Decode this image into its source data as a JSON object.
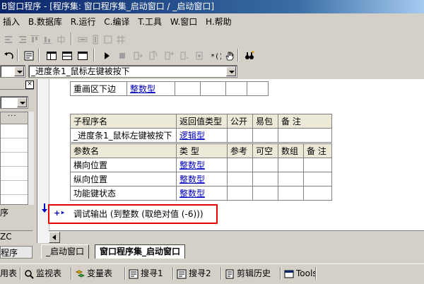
{
  "window": {
    "title": "B窗口程序 - [程序集: 窗口程序集_启动窗口 / _启动窗口]"
  },
  "menu": [
    {
      "label": "插入"
    },
    {
      "label": "B.数据库"
    },
    {
      "label": "R.运行"
    },
    {
      "label": "C.编译"
    },
    {
      "label": "T.工具"
    },
    {
      "label": "W.窗口"
    },
    {
      "label": "H.帮助"
    }
  ],
  "combo": {
    "selected": "_进度条1_鼠标左键被按下"
  },
  "left_panel": {
    "label1": "序",
    "label2": "ZC",
    "label3": "程序"
  },
  "top_table": {
    "cell1": "重画区下边",
    "cell2": "整数型"
  },
  "sub_table": {
    "header": [
      "子程序名",
      "返回值类型",
      "公开",
      "易包",
      "备 注"
    ],
    "row": [
      "_进度条1_鼠标左键被按下",
      "逻辑型"
    ],
    "param_header": [
      "参数名",
      "类 型",
      "参考",
      "可空",
      "数组",
      "备 注"
    ],
    "params": [
      {
        "name": "横向位置",
        "type": "整数型"
      },
      {
        "name": "纵向位置",
        "type": "整数型"
      },
      {
        "name": "功能键状态",
        "type": "整数型"
      }
    ]
  },
  "code": {
    "prefix": "+‣",
    "line": "调试输出 (到整数 (取绝对值 (-6)))"
  },
  "tabs": [
    {
      "label": "_启动窗口"
    },
    {
      "label": "窗口程序集_启动窗口"
    }
  ],
  "bottom_bar": [
    {
      "label": "用表",
      "icon": "table-icon"
    },
    {
      "label": "监视表",
      "icon": "search-icon"
    },
    {
      "label": "变量表",
      "icon": "variables-icon"
    },
    {
      "label": "搜寻1",
      "icon": "find-icon"
    },
    {
      "label": "搜寻2",
      "icon": "find-icon"
    },
    {
      "label": "剪辑历史",
      "icon": "clipboard-icon"
    },
    {
      "label": "Tools",
      "icon": "tools-icon"
    }
  ],
  "colors": {
    "highlight": "#e60000",
    "type_link": "#0000c0",
    "title_bar": "#0a246a"
  }
}
